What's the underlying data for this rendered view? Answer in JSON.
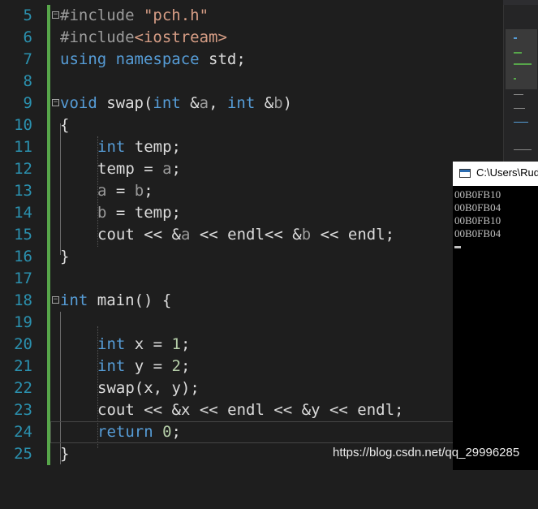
{
  "editor": {
    "line_numbers": [
      "5",
      "6",
      "7",
      "8",
      "9",
      "10",
      "11",
      "12",
      "13",
      "14",
      "15",
      "16",
      "17",
      "18",
      "19",
      "20",
      "21",
      "22",
      "23",
      "24",
      "25"
    ],
    "lines": {
      "l5": {
        "t1": "#include ",
        "t2": "\"pch.h\""
      },
      "l6": {
        "t1": "#include",
        "t2": "<iostream>"
      },
      "l7": {
        "t1": "using",
        "t2": " ",
        "t3": "namespace",
        "t4": " std;"
      },
      "l9": {
        "t1": "void",
        "t2": " swap(",
        "t3": "int",
        "t4": " &",
        "t5": "a",
        "t6": ", ",
        "t7": "int",
        "t8": " &",
        "t9": "b",
        "t10": ")"
      },
      "l10": {
        "t1": "{"
      },
      "l11": {
        "t1": "int",
        "t2": " temp;"
      },
      "l12": {
        "t1": "temp = ",
        "t2": "a",
        "t3": ";"
      },
      "l13": {
        "t1": "a",
        "t2": " = ",
        "t3": "b",
        "t4": ";"
      },
      "l14": {
        "t1": "b",
        "t2": " = temp;"
      },
      "l15": {
        "t1": "cout << &",
        "t2": "a",
        "t3": " << endl<< &",
        "t4": "b",
        "t5": " << endl;"
      },
      "l16": {
        "t1": "}"
      },
      "l18": {
        "t1": "int",
        "t2": " main() {"
      },
      "l20": {
        "t1": "int",
        "t2": " x = ",
        "t3": "1",
        "t4": ";"
      },
      "l21": {
        "t1": "int",
        "t2": " y = ",
        "t3": "2",
        "t4": ";"
      },
      "l22": {
        "t1": "swap(x, y);"
      },
      "l23": {
        "t1": "cout << &x << endl << &y << endl;"
      },
      "l24": {
        "t1": "return",
        "t2": " ",
        "t3": "0",
        "t4": ";"
      },
      "l25": {
        "t1": "}"
      }
    }
  },
  "console": {
    "title": "C:\\Users\\Rud",
    "output": [
      "00B0FB10",
      "00B0FB04",
      "00B0FB10",
      "00B0FB04"
    ]
  },
  "watermark": "https://blog.csdn.net/qq_29996285",
  "colors": {
    "background": "#1e1e1e",
    "keyword": "#569cd6",
    "line_number": "#2b91af",
    "string": "#d69d85",
    "number": "#b5cea8",
    "change_bar": "#57a64a",
    "console_bg": "#000000",
    "console_text": "#c0c0c0"
  }
}
